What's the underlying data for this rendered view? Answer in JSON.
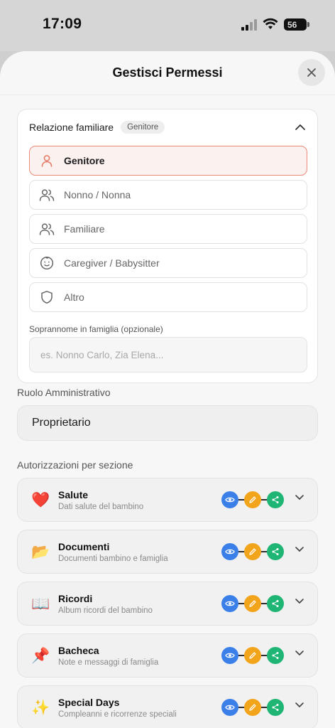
{
  "status_bar": {
    "time": "17:09",
    "battery": "56"
  },
  "sheet": {
    "title": "Gestisci Permessi"
  },
  "relation": {
    "title": "Relazione familiare",
    "badge": "Genitore",
    "options": [
      {
        "label": "Genitore",
        "icon": "person-icon",
        "selected": true
      },
      {
        "label": "Nonno / Nonna",
        "icon": "people-icon",
        "selected": false
      },
      {
        "label": "Familiare",
        "icon": "people-icon",
        "selected": false
      },
      {
        "label": "Caregiver / Babysitter",
        "icon": "baby-face-icon",
        "selected": false
      },
      {
        "label": "Altro",
        "icon": "shield-icon",
        "selected": false
      }
    ],
    "nickname_label": "Soprannome in famiglia (opzionale)",
    "nickname_placeholder": "es. Nonno Carlo, Zia Elena...",
    "nickname_value": ""
  },
  "admin_role": {
    "label": "Ruolo Amministrativo",
    "value": "Proprietario"
  },
  "permissions": {
    "label": "Autorizzazioni per sezione",
    "sections": [
      {
        "emoji": "❤️",
        "icon": "heart-icon",
        "title": "Salute",
        "subtitle": "Dati salute del bambino"
      },
      {
        "emoji": "📂",
        "icon": "folder-icon",
        "title": "Documenti",
        "subtitle": "Documenti bambino e famiglia"
      },
      {
        "emoji": "📖",
        "icon": "book-icon",
        "title": "Ricordi",
        "subtitle": "Album ricordi del bambino"
      },
      {
        "emoji": "📌",
        "icon": "pin-icon",
        "title": "Bacheca",
        "subtitle": "Note e messaggi di famiglia"
      },
      {
        "emoji": "✨",
        "icon": "sparkles-icon",
        "title": "Special Days",
        "subtitle": "Compleanni e ricorrenze speciali"
      }
    ]
  },
  "colors": {
    "selected_border": "#ec8b7a",
    "view": "#3b7fe8",
    "edit": "#f2a41b",
    "share": "#1fb575"
  }
}
